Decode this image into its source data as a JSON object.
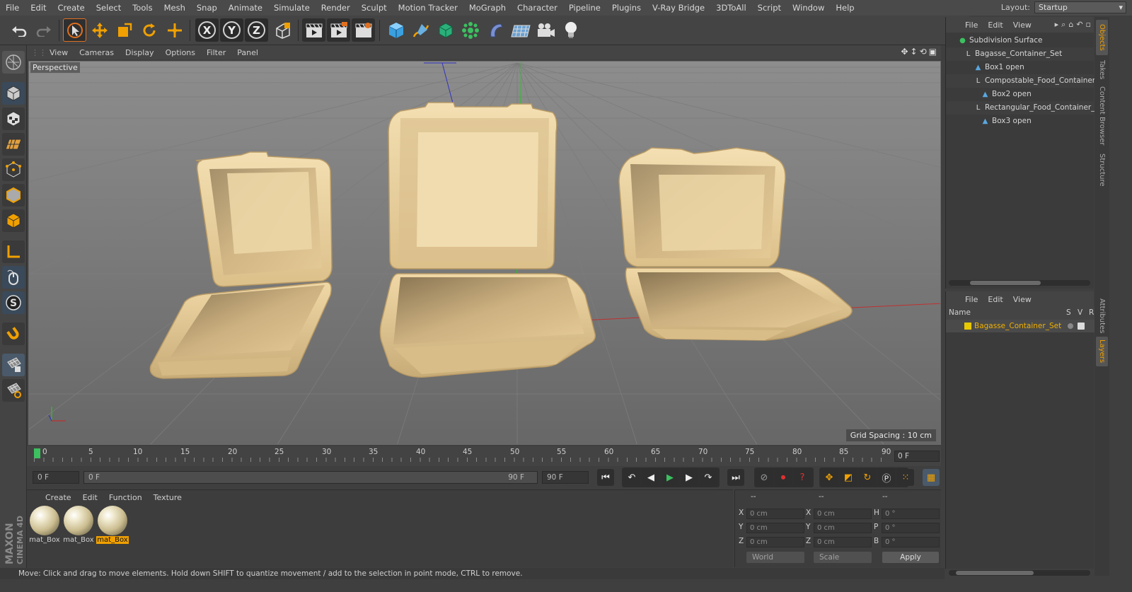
{
  "menubar": {
    "items": [
      "File",
      "Edit",
      "Create",
      "Select",
      "Tools",
      "Mesh",
      "Snap",
      "Animate",
      "Simulate",
      "Render",
      "Sculpt",
      "Motion Tracker",
      "MoGraph",
      "Character",
      "Pipeline",
      "Plugins",
      "V-Ray Bridge",
      "3DToAll",
      "Script",
      "Window",
      "Help"
    ],
    "layout_label": "Layout:",
    "layout_value": "Startup"
  },
  "toolbar": {
    "x_label": "X",
    "y_label": "Y",
    "z_label": "Z"
  },
  "viewport": {
    "menu": [
      "View",
      "Cameras",
      "Display",
      "Options",
      "Filter",
      "Panel"
    ],
    "camera_label": "Perspective",
    "grid_spacing": "Grid Spacing : 10 cm"
  },
  "timeline": {
    "ticks": [
      "0",
      "5",
      "10",
      "15",
      "20",
      "25",
      "30",
      "35",
      "40",
      "45",
      "50",
      "55",
      "60",
      "65",
      "70",
      "75",
      "80",
      "85",
      "90"
    ],
    "current_frame_right": "0 F"
  },
  "playback": {
    "start_frame": "0 F",
    "range_start": "0 F",
    "range_end": "90 F",
    "end_frame": "90 F"
  },
  "material_manager": {
    "menu": [
      "Create",
      "Edit",
      "Function",
      "Texture"
    ],
    "materials": [
      {
        "label": "mat_Box",
        "selected": false
      },
      {
        "label": "mat_Box",
        "selected": false
      },
      {
        "label": "mat_Box",
        "selected": true
      }
    ]
  },
  "coordinates": {
    "header_left": "--",
    "header_mid": "--",
    "header_right": "--",
    "rows": [
      {
        "pos_label": "X",
        "pos": "0 cm",
        "size_label": "X",
        "size": "0 cm",
        "rot_label": "H",
        "rot": "0 °"
      },
      {
        "pos_label": "Y",
        "pos": "0 cm",
        "size_label": "Y",
        "size": "0 cm",
        "rot_label": "P",
        "rot": "0 °"
      },
      {
        "pos_label": "Z",
        "pos": "0 cm",
        "size_label": "Z",
        "size": "0 cm",
        "rot_label": "B",
        "rot": "0 °"
      }
    ],
    "space": "World",
    "mode": "Scale",
    "apply_label": "Apply"
  },
  "status": {
    "text": "Move: Click and drag to move elements. Hold down SHIFT to quantize movement / add to the selection in point mode, CTRL to remove."
  },
  "logo": {
    "line1": "MAXON",
    "line2": "CINEMA 4D"
  },
  "objects_panel": {
    "menu": [
      "File",
      "Edit",
      "View"
    ],
    "tree": [
      {
        "name": "Subdivision Surface",
        "indent": 0,
        "icon": "subdivision-icon"
      },
      {
        "name": "Bagasse_Container_Set",
        "indent": 1,
        "icon": "null-icon"
      },
      {
        "name": "Box1 open",
        "indent": 2,
        "icon": "polygon-icon"
      },
      {
        "name": "Compostable_Food_Container",
        "indent": 2,
        "icon": "null-icon"
      },
      {
        "name": "Box2 open",
        "indent": 3,
        "icon": "polygon-icon"
      },
      {
        "name": "Rectangular_Food_Container_",
        "indent": 2,
        "icon": "null-icon"
      },
      {
        "name": "Box3 open",
        "indent": 3,
        "icon": "polygon-icon"
      }
    ]
  },
  "layers_panel": {
    "menu": [
      "File",
      "Edit",
      "View"
    ],
    "col_name": "Name",
    "col_s": "S",
    "col_v": "V",
    "col_r": "R",
    "layer_name": "Bagasse_Container_Set",
    "layer_color": "#e8c800"
  },
  "right_tabs": [
    "Objects",
    "Takes",
    "Content Browser",
    "Structure",
    "Attributes",
    "Layers"
  ],
  "colors": {
    "accent": "#f0a000",
    "container": "#e6cc98"
  }
}
